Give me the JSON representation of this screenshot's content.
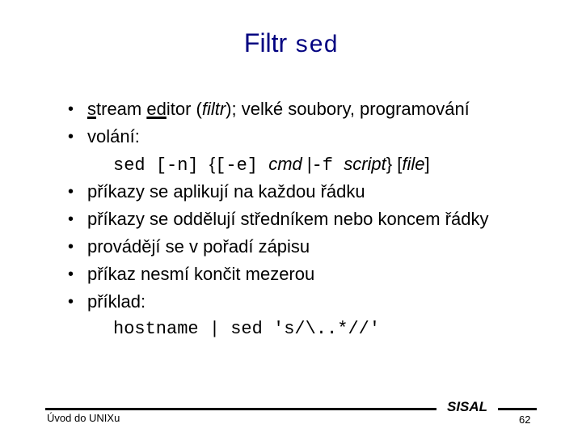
{
  "slide": {
    "title_text": "Filtr ",
    "title_code": "sed",
    "bullet_symbol": "•",
    "bullets": [
      {
        "s": "s",
        "tream": "tream ",
        "ed": "ed",
        "itor": "itor (",
        "filtr": "filtr",
        "rest": "); velké soubory, programování"
      },
      {
        "text": "volání:"
      }
    ],
    "syntax": {
      "sed": "sed ",
      "n": "[-n] ",
      "brace_open": "{",
      "e": "[-e] ",
      "cmd": "cmd ",
      "pipe": "|",
      "f": "-f ",
      "script": " script",
      "brace_close": "} ",
      "file_open": "[",
      "file": "file",
      "file_close": "]"
    },
    "bullets2": [
      "příkazy se aplikují na každou řádku",
      "příkazy se oddělují středníkem nebo koncem řádky",
      "provádějí se v pořadí zápisu",
      "příkaz nesmí končit mezerou",
      "příklad:"
    ],
    "example": "hostname | sed 's/\\..*//'"
  },
  "footer": {
    "left": "Úvod do UNIXu",
    "brand": "SISAL",
    "page": "62"
  }
}
